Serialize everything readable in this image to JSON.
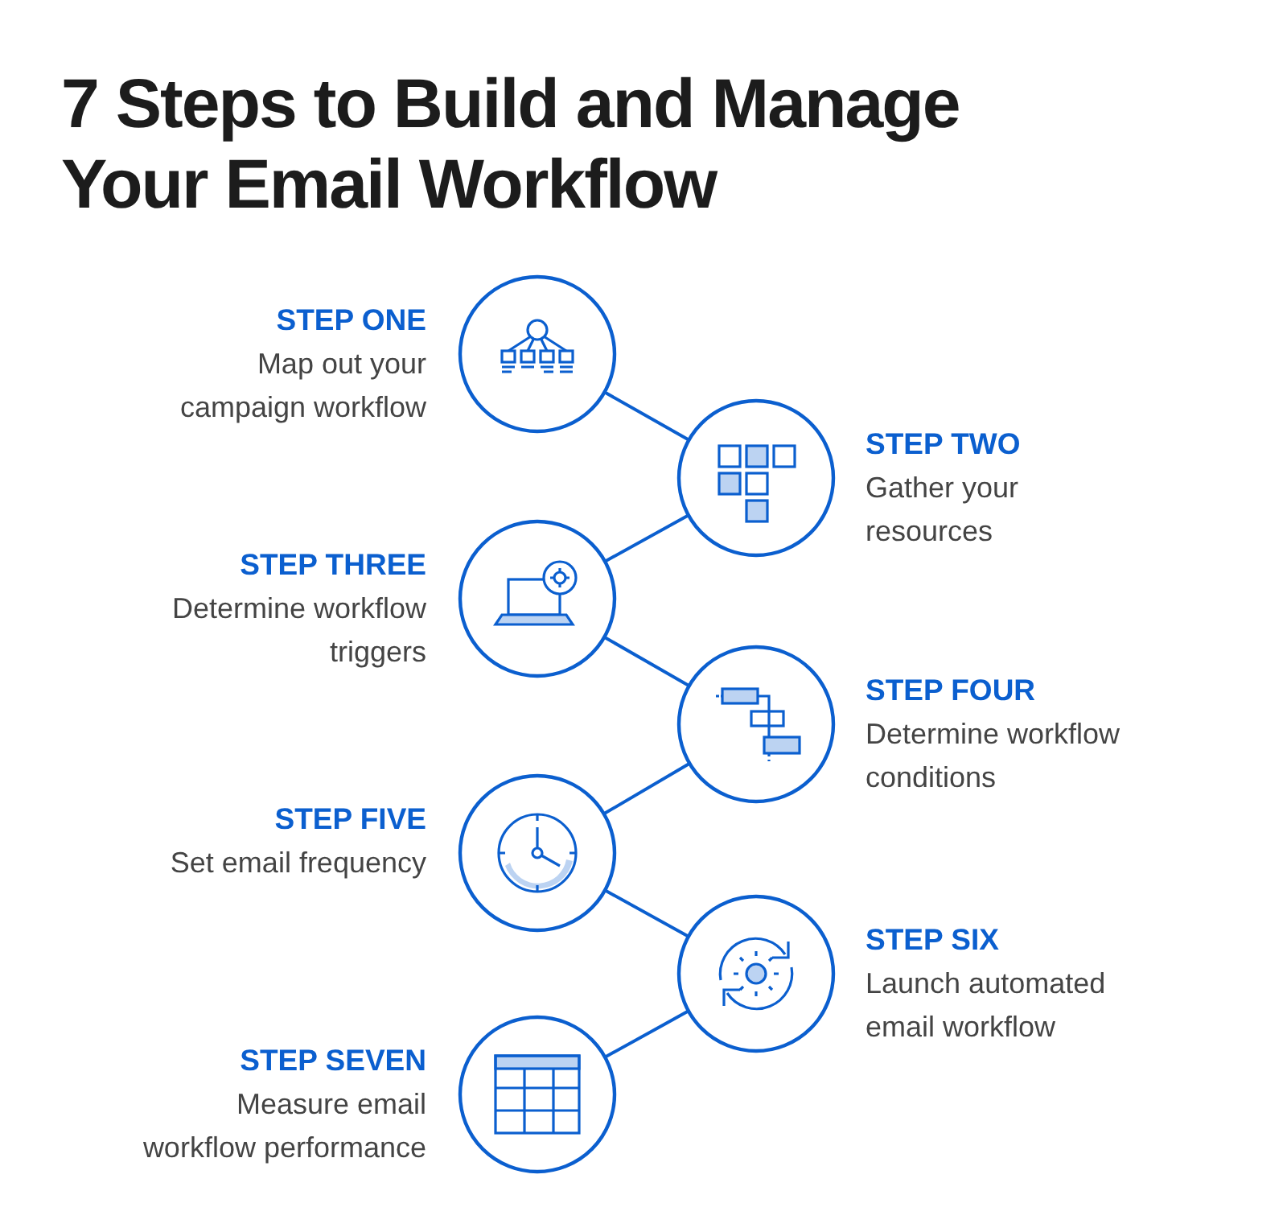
{
  "title_lines": [
    "7 Steps to Build and Manage",
    "Your Email Workflow"
  ],
  "steps": [
    {
      "label": "STEP ONE",
      "description_lines": [
        "Map out your",
        "campaign workflow"
      ]
    },
    {
      "label": "STEP TWO",
      "description_lines": [
        "Gather your",
        "resources"
      ]
    },
    {
      "label": "STEP THREE",
      "description_lines": [
        "Determine workflow",
        "triggers"
      ]
    },
    {
      "label": "STEP FOUR",
      "description_lines": [
        "Determine workflow",
        "conditions"
      ]
    },
    {
      "label": "STEP FIVE",
      "description_lines": [
        "Set email frequency"
      ]
    },
    {
      "label": "STEP SIX",
      "description_lines": [
        "Launch automated",
        "email workflow"
      ]
    },
    {
      "label": "STEP SEVEN",
      "description_lines": [
        "Measure email",
        "workflow performance"
      ]
    }
  ]
}
